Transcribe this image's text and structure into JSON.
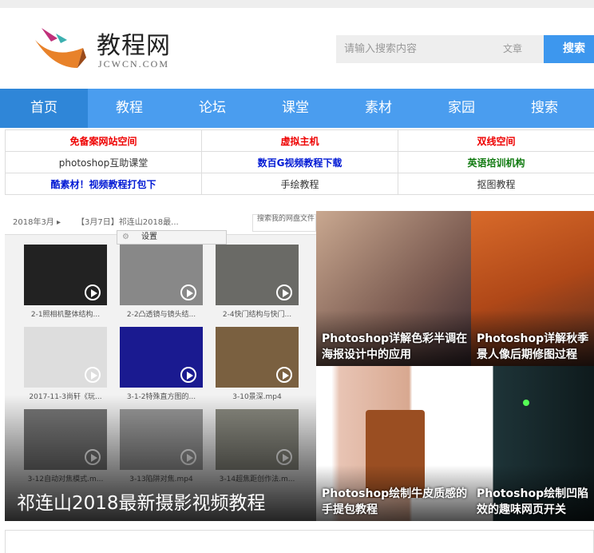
{
  "header": {
    "brand": "教程网",
    "domain": "JCWCN.COM",
    "search_placeholder": "请输入搜索内容",
    "search_type": "文章",
    "search_button": "搜索"
  },
  "nav": [
    "首页",
    "教程",
    "论坛",
    "课堂",
    "素材",
    "家园",
    "搜索"
  ],
  "links": [
    [
      {
        "t": "免备案网站空间",
        "c": "red"
      },
      {
        "t": "虚拟主机",
        "c": "red"
      },
      {
        "t": "双线空间",
        "c": "red"
      }
    ],
    [
      {
        "t": "photoshop互助课堂",
        "c": ""
      },
      {
        "t": "数百G视频教程下载",
        "c": "blue"
      },
      {
        "t": "英语培训机构",
        "c": "green"
      }
    ],
    [
      {
        "t": "酷素材！视频教程打包下",
        "c": "blue"
      },
      {
        "t": "手绘教程",
        "c": ""
      },
      {
        "t": "抠图教程",
        "c": ""
      }
    ]
  ],
  "feature": {
    "crumb": "2018年3月  ▸",
    "crumb2": "【3月7日】祁连山2018最...",
    "search": "搜索我的网盘文件",
    "menu": "设置",
    "thumbs": [
      "2-1照相机整体结构...",
      "2-2凸透镜与镜头结...",
      "2-4快门结构与快门...",
      "2017-11-3尚轩《玩...",
      "3-1-2特殊直方图的...",
      "3-10景深.mp4",
      "3-12自动对焦模式.m...",
      "3-13陷阱对焦.mp4",
      "3-14超焦距创作法.m..."
    ],
    "title": "祁连山2018最新摄影视频教程"
  },
  "tiles": [
    "Photoshop详解色彩半调在海报设计中的应用",
    "Photoshop详解秋季景人像后期修图过程",
    "Photoshop绘制牛皮质感的手提包教程",
    "Photoshop绘制凹陷效的趣味网页开关"
  ]
}
